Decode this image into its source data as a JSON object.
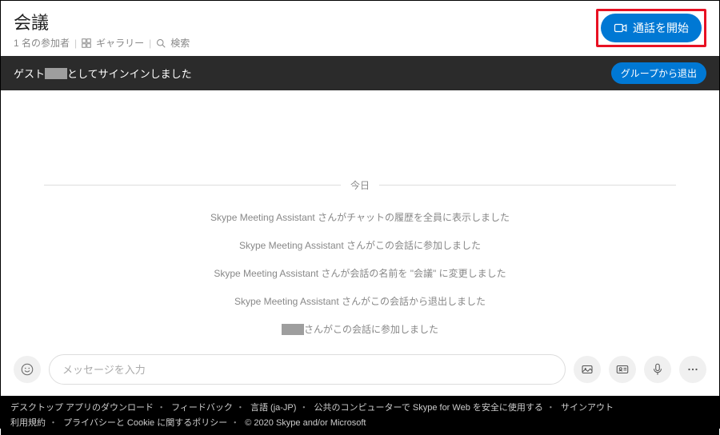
{
  "header": {
    "title": "会議",
    "participants": "1 名の参加者",
    "gallery": "ギャラリー",
    "search": "検索",
    "start_call": "通話を開始"
  },
  "bar": {
    "guest_prefix": "ゲスト",
    "guest_suffix": "としてサインインしました",
    "leave": "グループから退出"
  },
  "divider_label": "今日",
  "messages": [
    "Skype Meeting Assistant さんがチャットの履歴を全員に表示しました",
    "Skype Meeting Assistant さんがこの会話に参加しました",
    "Skype Meeting Assistant さんが会話の名前を \"会議\" に変更しました",
    "Skype Meeting Assistant さんがこの会話から退出しました"
  ],
  "message_last_suffix": "さんがこの会話に参加しました",
  "input": {
    "placeholder": "メッセージを入力"
  },
  "footer": {
    "links": [
      "デスクトップ アプリのダウンロード",
      "フィードバック",
      "言語 (ja-JP)",
      "公共のコンピューターで Skype for Web を安全に使用する",
      "サインアウト",
      "利用規約",
      "プライバシーと Cookie に関するポリシー"
    ],
    "copyright": "© 2020 Skype and/or Microsoft"
  }
}
